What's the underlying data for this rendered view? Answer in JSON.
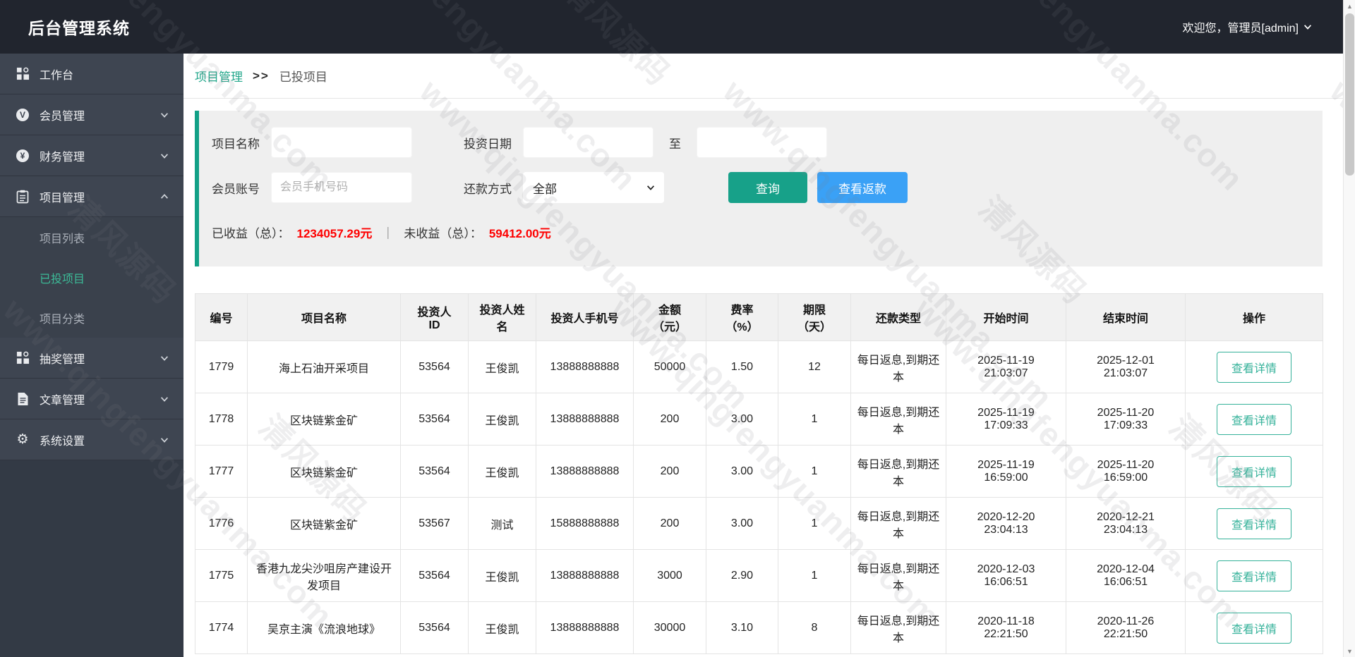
{
  "header": {
    "title": "后台管理系统",
    "welcome": "欢迎您，管理员[admin]"
  },
  "sidebar": {
    "items": [
      {
        "label": "工作台",
        "icon": "dashboard-grid-icon",
        "expandable": false
      },
      {
        "label": "会员管理",
        "icon": "member-icon",
        "icon_glyph": "V",
        "expandable": true,
        "state": "collapsed"
      },
      {
        "label": "财务管理",
        "icon": "finance-icon",
        "icon_glyph": "¥",
        "expandable": true,
        "state": "collapsed"
      },
      {
        "label": "项目管理",
        "icon": "project-clipboard-icon",
        "expandable": true,
        "state": "expanded",
        "children": [
          {
            "label": "项目列表",
            "active": false
          },
          {
            "label": "已投项目",
            "active": true
          },
          {
            "label": "项目分类",
            "active": false
          }
        ]
      },
      {
        "label": "抽奖管理",
        "icon": "lottery-grid-icon",
        "expandable": true,
        "state": "collapsed"
      },
      {
        "label": "文章管理",
        "icon": "article-icon",
        "expandable": true,
        "state": "collapsed"
      },
      {
        "label": "系统设置",
        "icon": "gear-icon",
        "icon_glyph": "⚙",
        "expandable": true,
        "state": "collapsed"
      }
    ]
  },
  "breadcrumb": {
    "parent": "项目管理",
    "separator": ">>",
    "current": "已投项目"
  },
  "filters": {
    "project_name_label": "项目名称",
    "project_name_value": "",
    "invest_date_label": "投资日期",
    "invest_date_from_value": "",
    "to_label": "至",
    "invest_date_to_value": "",
    "member_account_label": "会员账号",
    "member_account_placeholder": "会员手机号码",
    "member_account_value": "",
    "repay_method_label": "还款方式",
    "repay_method_value": "全部",
    "search_button": "查询",
    "view_refund_button": "查看返款"
  },
  "summary": {
    "earned_label": "已收益（总）：",
    "earned_value": "1234057.29元",
    "divider": "｜",
    "unearned_label": "未收益（总）：",
    "unearned_value": "59412.00元"
  },
  "table": {
    "headers": [
      "编号",
      "项目名称",
      "投资人\nID",
      "投资人姓\n名",
      "投资人手机号",
      "金额\n（元）",
      "费率\n（%）",
      "期限\n（天）",
      "还款类型",
      "开始时间",
      "结束时间",
      "操作"
    ],
    "action_label": "查看详情",
    "rows": [
      [
        "1779",
        "海上石油开采项目",
        "53564",
        "王俊凯",
        "13888888888",
        "50000",
        "1.50",
        "12",
        "每日返息,到期还本",
        "2025-11-19\n21:03:07",
        "2025-12-01\n21:03:07"
      ],
      [
        "1778",
        "区块链紫金矿",
        "53564",
        "王俊凯",
        "13888888888",
        "200",
        "3.00",
        "1",
        "每日返息,到期还本",
        "2025-11-19\n17:09:33",
        "2025-11-20\n17:09:33"
      ],
      [
        "1777",
        "区块链紫金矿",
        "53564",
        "王俊凯",
        "13888888888",
        "200",
        "3.00",
        "1",
        "每日返息,到期还本",
        "2025-11-19\n16:59:00",
        "2025-11-20\n16:59:00"
      ],
      [
        "1776",
        "区块链紫金矿",
        "53567",
        "测试",
        "15888888888",
        "200",
        "3.00",
        "1",
        "每日返息,到期还本",
        "2020-12-20\n23:04:13",
        "2020-12-21\n23:04:13"
      ],
      [
        "1775",
        "香港九龙尖沙咀房产建设开发项目",
        "53564",
        "王俊凯",
        "13888888888",
        "3000",
        "2.90",
        "1",
        "每日返息,到期还本",
        "2020-12-03\n16:06:51",
        "2020-12-04\n16:06:51"
      ],
      [
        "1774",
        "吴京主演《流浪地球》",
        "53564",
        "王俊凯",
        "13888888888",
        "30000",
        "3.10",
        "8",
        "每日返息,到期还本",
        "2020-11-18\n22:21:50",
        "2020-11-26\n22:21:50"
      ]
    ]
  },
  "watermark": {
    "text_en": "www.qingfengyuanma.com",
    "text_cn": "清风源码"
  },
  "colors": {
    "header_bg": "#21252e",
    "sidebar_bg": "#3e4551",
    "accent_teal": "#17a189",
    "active_menu_teal": "#3cbc98",
    "refund_blue": "#3aa1f6",
    "summary_red": "#fe0000",
    "filter_bg": "#efefef"
  }
}
